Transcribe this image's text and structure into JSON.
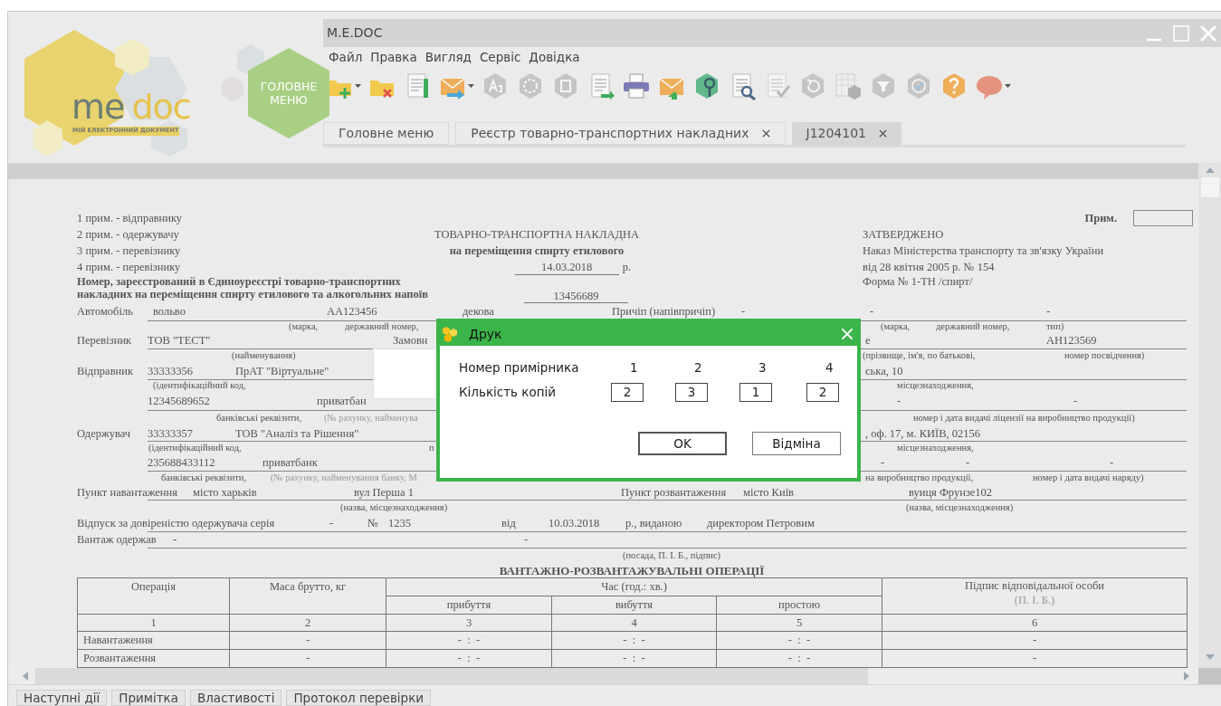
{
  "app": {
    "title": "M.E.DOC",
    "logo": {
      "word1": "me",
      "word2": "doc",
      "tagline": "МІЙ ЕЛЕКТРОННИЙ ДОКУМЕНТ"
    },
    "main_menu_tile": [
      "ГОЛОВНЕ",
      "МЕНЮ"
    ]
  },
  "menu": [
    "Файл",
    "Правка",
    "Вигляд",
    "Сервіс",
    "Довідка"
  ],
  "toolbar": [
    {
      "kind": "folder-add",
      "disabled": false,
      "dropdown": true
    },
    {
      "kind": "folder-remove",
      "disabled": false,
      "dropdown": false
    },
    {
      "kind": "pages",
      "disabled": false,
      "dropdown": false
    },
    {
      "kind": "envelope-send",
      "disabled": false,
      "dropdown": true
    },
    {
      "kind": "hex-text",
      "disabled": true,
      "dropdown": false
    },
    {
      "kind": "hex-dashed",
      "disabled": true,
      "dropdown": false
    },
    {
      "kind": "hex-box",
      "disabled": true,
      "dropdown": false
    },
    {
      "kind": "page-arrow",
      "disabled": false,
      "dropdown": false
    },
    {
      "kind": "printer",
      "disabled": false,
      "dropdown": false
    },
    {
      "kind": "envelope-receive",
      "disabled": false,
      "dropdown": false
    },
    {
      "kind": "hex-search",
      "disabled": false,
      "dropdown": false
    },
    {
      "kind": "page-search",
      "disabled": false,
      "dropdown": false
    },
    {
      "kind": "page-check",
      "disabled": true,
      "dropdown": false
    },
    {
      "kind": "hex-refresh",
      "disabled": true,
      "dropdown": false
    },
    {
      "kind": "grid-calc",
      "disabled": true,
      "dropdown": false
    },
    {
      "kind": "hex-funnel",
      "disabled": true,
      "dropdown": false
    },
    {
      "kind": "hex-check",
      "disabled": true,
      "dropdown": false
    },
    {
      "kind": "hex-help",
      "disabled": false,
      "dropdown": false
    },
    {
      "kind": "speech-bubble",
      "disabled": false,
      "dropdown": true
    }
  ],
  "tabs": [
    {
      "label": "Головне меню",
      "closable": false,
      "selected": false
    },
    {
      "label": "Реєстр товарно-транспортних накладних",
      "closable": true,
      "selected": false
    },
    {
      "label": "J1204101",
      "closable": true,
      "selected": true
    }
  ],
  "document": {
    "copy_notes": [
      "1 прим. - відправнику",
      "2 прим. - одержувачу",
      "3 прим. - перевізнику",
      "4 прим. - перевізнику"
    ],
    "prim_label": "Прим.",
    "title": "ТОВАРНО-ТРАНСПОРТНА НАКЛАДНА",
    "subtitle": "на переміщення спирту етилового",
    "date": "14.03.2018",
    "date_suffix": "р.",
    "approval": [
      "ЗАТВЕРДЖЕНО",
      "Наказ Міністерства транспорту та зв'язку України",
      "від 28 квітня 2005 р. № 154",
      "Форма № 1-ТН /спирт/"
    ],
    "register_label": [
      "Номер, зареєстрований в Єдиноуреєстрі товарно-транспортних",
      "накладних на переміщення спирту етилового та алкогольних напоїв"
    ],
    "register_number": "13456689",
    "form_rows": [
      {
        "cells": [
          {
            "text": "Автомобіль",
            "kind": "label"
          },
          {
            "text": "вольво",
            "kind": "value"
          },
          {
            "text": "AA123456",
            "kind": "value"
          },
          {
            "text": "декова",
            "kind": "value"
          },
          {
            "text": "Причіп (напівпричіп)",
            "kind": "label"
          },
          {
            "text": "-",
            "kind": "value"
          },
          {
            "text": "-",
            "kind": "value"
          },
          {
            "text": "-",
            "kind": "value"
          }
        ]
      },
      {
        "cells": [
          {
            "text": "(марка,",
            "kind": "caption"
          },
          {
            "text": "державний номер,",
            "kind": "caption"
          },
          {
            "text": "(марка,",
            "kind": "caption"
          },
          {
            "text": "державний номер,",
            "kind": "caption"
          },
          {
            "text": "тип)",
            "kind": "caption"
          }
        ]
      },
      {
        "cells": [
          {
            "text": "Перевізник",
            "kind": "label"
          },
          {
            "text": "ТОВ \"ТЕСТ\"",
            "kind": "value"
          },
          {
            "text": "Замовн",
            "kind": "label"
          },
          {
            "text": "е",
            "kind": "value"
          },
          {
            "text": "AH123569",
            "kind": "value"
          }
        ]
      },
      {
        "cells": [
          {
            "text": "(найменування)",
            "kind": "caption"
          },
          {
            "text": "(прізвище, ім'я, по батькові,",
            "kind": "caption"
          },
          {
            "text": "номер посвідчення)",
            "kind": "caption"
          }
        ]
      },
      {
        "cells": [
          {
            "text": "Відправник",
            "kind": "label"
          },
          {
            "text": "33333356",
            "kind": "value"
          },
          {
            "text": "ПрАТ \"Віртуальне\"",
            "kind": "value"
          },
          {
            "text": "ська, 10",
            "kind": "value"
          }
        ]
      },
      {
        "cells": [
          {
            "text": "(ідентифікаційний код,",
            "kind": "caption"
          },
          {
            "text": "місцезнаходження,",
            "kind": "caption"
          }
        ]
      },
      {
        "cells": [
          {
            "text": "12345689652",
            "kind": "value"
          },
          {
            "text": "приватбан",
            "kind": "value"
          },
          {
            "text": "-",
            "kind": "value"
          },
          {
            "text": "-",
            "kind": "value"
          }
        ]
      },
      {
        "cells": [
          {
            "text": "банківські реквізити,",
            "kind": "caption"
          },
          {
            "text": "(№ рахунку, найменува",
            "kind": "hint"
          },
          {
            "text": "номер і дата видачі ліцензії на виробництво продукції)",
            "kind": "caption"
          }
        ]
      },
      {
        "cells": [
          {
            "text": "Одержувач",
            "kind": "label"
          },
          {
            "text": "33333357",
            "kind": "value"
          },
          {
            "text": "ТОВ \"Аналіз та Рішення\"",
            "kind": "value"
          },
          {
            "text": ", оф. 17, м. КИЇВ, 02156",
            "kind": "value"
          }
        ]
      },
      {
        "cells": [
          {
            "text": "(ідентифікаційний код,",
            "kind": "caption"
          },
          {
            "text": "п",
            "kind": "caption"
          },
          {
            "text": "місцезнаходження,",
            "kind": "caption"
          }
        ]
      },
      {
        "cells": [
          {
            "text": "235688433112",
            "kind": "value"
          },
          {
            "text": "приватбанк",
            "kind": "value"
          },
          {
            "text": "-",
            "kind": "value"
          },
          {
            "text": "-",
            "kind": "value"
          },
          {
            "text": "-",
            "kind": "value"
          }
        ]
      },
      {
        "cells": [
          {
            "text": "банківські реквізити,",
            "kind": "caption"
          },
          {
            "text": "(№ рахунку, найменування банку, М",
            "kind": "hint"
          },
          {
            "text": "на виробництво продукції,",
            "kind": "caption"
          },
          {
            "text": "номер і дата видачі наряду)",
            "kind": "caption"
          }
        ]
      },
      {
        "cells": [
          {
            "text": "Пункт навантаження",
            "kind": "label"
          },
          {
            "text": "місто харьків",
            "kind": "value"
          },
          {
            "text": "вул Перша 1",
            "kind": "value"
          },
          {
            "text": "Пункт розвантаження",
            "kind": "label"
          },
          {
            "text": "місто Київ",
            "kind": "value"
          },
          {
            "text": "вуиця Фрунзе102",
            "kind": "value"
          }
        ]
      },
      {
        "cells": [
          {
            "text": "(назва, місцезнаходження)",
            "kind": "caption"
          },
          {
            "text": "(назва, місцезнаходження)",
            "kind": "caption"
          }
        ]
      },
      {
        "cells": [
          {
            "text": "Відпуск за довіреністю одержувача серія",
            "kind": "label"
          },
          {
            "text": "-",
            "kind": "value"
          },
          {
            "text": "№",
            "kind": "label"
          },
          {
            "text": "1235",
            "kind": "value"
          },
          {
            "text": "від",
            "kind": "label"
          },
          {
            "text": "10.03.2018",
            "kind": "value"
          },
          {
            "text": "р., виданою",
            "kind": "label"
          },
          {
            "text": "директором Петровим",
            "kind": "value"
          }
        ]
      },
      {
        "cells": [
          {
            "text": "Вантаж одержав",
            "kind": "label"
          },
          {
            "text": "-",
            "kind": "value"
          },
          {
            "text": "-",
            "kind": "value"
          }
        ]
      },
      {
        "cells": [
          {
            "text": "(посада, П. І. Б., підпис)",
            "kind": "caption"
          }
        ]
      }
    ],
    "operations_title": "ВАНТАЖНО-РОЗВАНТАЖУВАЛЬНІ ОПЕРАЦІЇ",
    "operations_table": {
      "operation": "Операція",
      "mass": "Маса брутто, кг",
      "time": "Час (год.: хв.)",
      "arrival": "прибуття",
      "departure": "вибуття",
      "idle": "простою",
      "signature": "Підпис відповідальної особи",
      "signature_hint": "(П. І. Б.)",
      "numbers": [
        "1",
        "2",
        "3",
        "4",
        "5",
        "6"
      ],
      "rows": [
        {
          "cells": [
            "Навантаження",
            "-",
            "-  :  -",
            "-  :  -",
            "-  :  -",
            "-"
          ]
        },
        {
          "cells": [
            "Розвантаження",
            "-",
            "-  :  -",
            "-  :  -",
            "-  :  -",
            "-"
          ]
        }
      ]
    }
  },
  "dialog": {
    "title": "Друк",
    "row1_label": "Номер примірника",
    "numbers": [
      "1",
      "2",
      "3",
      "4"
    ],
    "row2_label": "Кількість копій",
    "copies": [
      "2",
      "3",
      "1",
      "2"
    ],
    "buttons": [
      "OK",
      "Відміна"
    ]
  },
  "bottom_tabs": [
    "Наступні дії",
    "Примітка",
    "Властивості",
    "Протокол перевірки"
  ]
}
